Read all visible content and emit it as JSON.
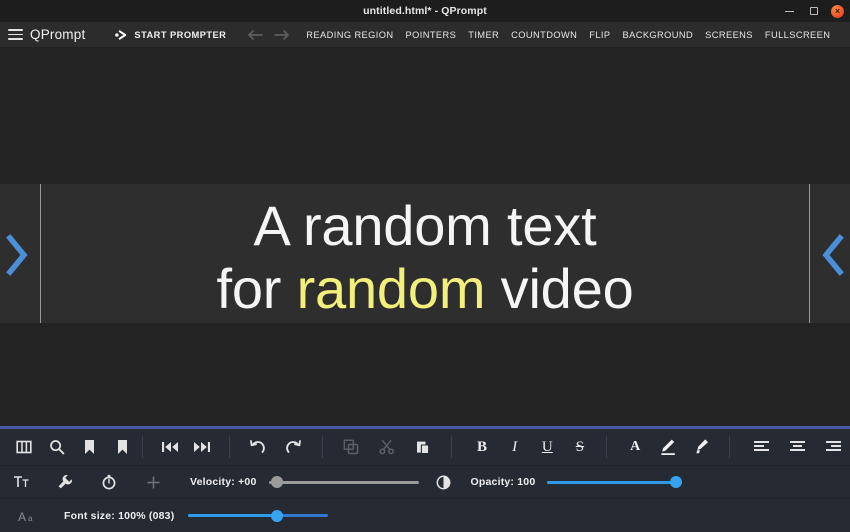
{
  "window": {
    "title": "untitled.html* - QPrompt",
    "controls": {
      "minimize": "minimize-button",
      "maximize": "maximize-button",
      "close": "×"
    }
  },
  "menubar": {
    "brand": "QPrompt",
    "start_prompter": "START PROMPTER",
    "nav_back_icon": "arrow-left-icon",
    "nav_forward_icon": "arrow-right-icon",
    "items": [
      {
        "label": "READING REGION"
      },
      {
        "label": "POINTERS"
      },
      {
        "label": "TIMER"
      },
      {
        "label": "COUNTDOWN"
      },
      {
        "label": "FLIP"
      },
      {
        "label": "BACKGROUND"
      },
      {
        "label": "SCREENS"
      },
      {
        "label": "FULLSCREEN"
      }
    ]
  },
  "prompter": {
    "line1": "A random text",
    "line2_before": "for ",
    "line2_highlight": "random",
    "line2_after": " video",
    "highlight_color": "#f2f07a",
    "text_color": "#f5f5f5",
    "pointer_color": "#4a90d9",
    "reading_region_bg": "#2e2e2e"
  },
  "format_toolbar": {
    "buttons": [
      {
        "name": "panel-toggle-icon",
        "enabled": true
      },
      {
        "name": "search-icon",
        "enabled": true
      },
      {
        "name": "bookmark-add-icon",
        "enabled": true
      },
      {
        "name": "bookmark-icon",
        "enabled": true
      },
      {
        "name": "skip-previous-icon",
        "enabled": true
      },
      {
        "name": "skip-next-icon",
        "enabled": true
      },
      {
        "name": "undo-icon",
        "enabled": true
      },
      {
        "name": "redo-icon",
        "enabled": true
      },
      {
        "name": "copy-icon",
        "enabled": false
      },
      {
        "name": "cut-icon",
        "enabled": false
      },
      {
        "name": "paste-icon",
        "enabled": true
      },
      {
        "name": "bold-icon",
        "label": "B",
        "enabled": true
      },
      {
        "name": "italic-icon",
        "label": "I",
        "enabled": true
      },
      {
        "name": "underline-icon",
        "label": "U",
        "enabled": true
      },
      {
        "name": "strikethrough-icon",
        "label": "S",
        "enabled": true
      },
      {
        "name": "font-color-icon",
        "label": "A",
        "enabled": true
      },
      {
        "name": "text-color-pen-icon",
        "enabled": true
      },
      {
        "name": "highlight-brush-icon",
        "enabled": true
      },
      {
        "name": "align-left-icon",
        "enabled": true
      },
      {
        "name": "align-center-icon",
        "enabled": true
      },
      {
        "name": "align-right-icon",
        "enabled": true
      }
    ]
  },
  "controls_row": {
    "text_settings_icon": "text-format-icon",
    "wrench_icon": "wrench-icon",
    "timer_icon": "stopwatch-icon",
    "add_icon": "plus-icon",
    "velocity": {
      "label": "Velocity: +00",
      "value": 0,
      "percent": 4
    },
    "contrast_icon": "contrast-icon",
    "opacity": {
      "label": "Opacity: 100",
      "value": 100,
      "percent": 100
    }
  },
  "fontsize_row": {
    "icon": "font-size-icon",
    "label": "Font size: 100% (083)",
    "value": 100,
    "display_px": "083",
    "percent": 63
  }
}
